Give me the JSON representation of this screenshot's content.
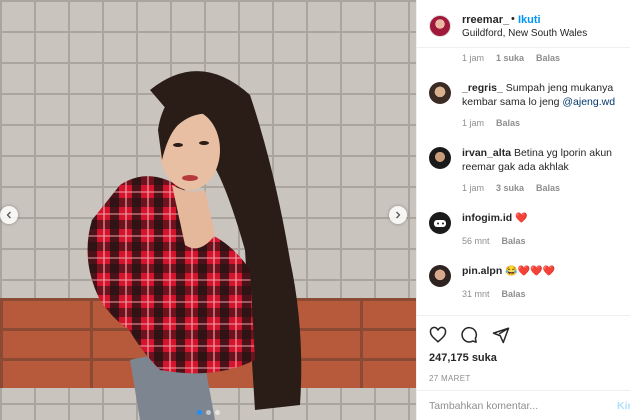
{
  "header": {
    "username": "rreemar_",
    "dot": "•",
    "follow_label": "Ikuti",
    "location": "Guildford, New South Wales",
    "more": "…"
  },
  "caption_meta": {
    "time": "1 jam",
    "likes": "1 suka",
    "reply": "Balas"
  },
  "comments": [
    {
      "user": "_regris_",
      "text": "Sumpah jeng mukanya kembar sama lo jeng",
      "mention": "@ajeng.wd",
      "time": "1 jam",
      "reply": "Balas"
    },
    {
      "user": "irvan_alta",
      "text": "Betina yg lporin akun reemar gak ada akhlak",
      "time": "1 jam",
      "likes": "3 suka",
      "reply": "Balas"
    },
    {
      "user": "infogim.id",
      "text": "❤️",
      "time": "56 mnt",
      "reply": "Balas"
    },
    {
      "user": "pin.alpn",
      "text": "😂❤️❤️❤️",
      "time": "31 mnt",
      "reply": "Balas"
    }
  ],
  "actions": {
    "like_icon": "heart-outline-icon",
    "comment_icon": "comment-bubble-icon",
    "share_icon": "paper-plane-icon",
    "likes": "247,175 suka",
    "date": "27 MARET"
  },
  "comment_box": {
    "placeholder": "Tambahkan komentar...",
    "post": "Kirim"
  },
  "colors": {
    "link_blue": "#0095f6",
    "mention_blue": "#00376b",
    "muted": "#8e8e8e",
    "heart_red": "#ed1c24"
  }
}
